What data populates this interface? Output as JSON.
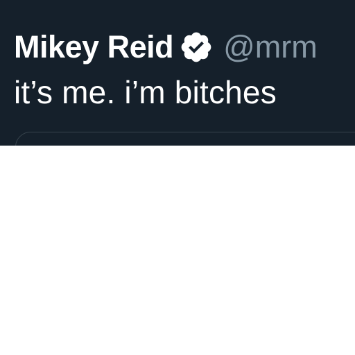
{
  "tweet": {
    "display_name": "Mikey Reid",
    "handle": "@mrm",
    "text": "it’s me. i’m bitches",
    "verified_icon": "verified-badge-icon"
  },
  "colors": {
    "background": "#15202b",
    "name": "#ffffff",
    "handle": "#8899a6",
    "card_border": "#38444d"
  }
}
